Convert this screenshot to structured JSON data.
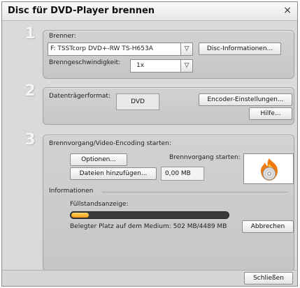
{
  "title": "Disc für DVD-Player brennen",
  "close_glyph": "×",
  "steps": [
    "1",
    "2",
    "3"
  ],
  "section1": {
    "burner_label": "Brenner:",
    "burner_value": "F: TSSTcorp DVD+-RW TS-H653A",
    "disc_info_button": "Disc-Informationen...",
    "speed_label": "Brenngeschwindigkeit:",
    "speed_value": "1x"
  },
  "section2": {
    "format_label": "Datenträgerformat:",
    "format_value": "DVD",
    "encoder_button": "Encoder-Einstellungen...",
    "help_button": "Hilfe..."
  },
  "section3": {
    "heading": "Brennvorgang/Video-Encoding starten:",
    "options_button": "Optionen...",
    "add_files_button": "Dateien hinzufügen...",
    "size_value": "0,00 MB",
    "start_burn_label": "Brennvorgang starten:",
    "burn_icon": "disc-flame-icon",
    "info_heading": "Informationen",
    "fill_label": "Füllstandsanzeige:",
    "fill_fraction": 0.112,
    "used_space": "Belegter Platz auf dem Medium: 502 MB/4489 MB",
    "cancel_button": "Abbrechen"
  },
  "close_button": "Schließen",
  "colors": {
    "accent_fill": "#f39a12",
    "flame_orange": "#f07a10"
  }
}
